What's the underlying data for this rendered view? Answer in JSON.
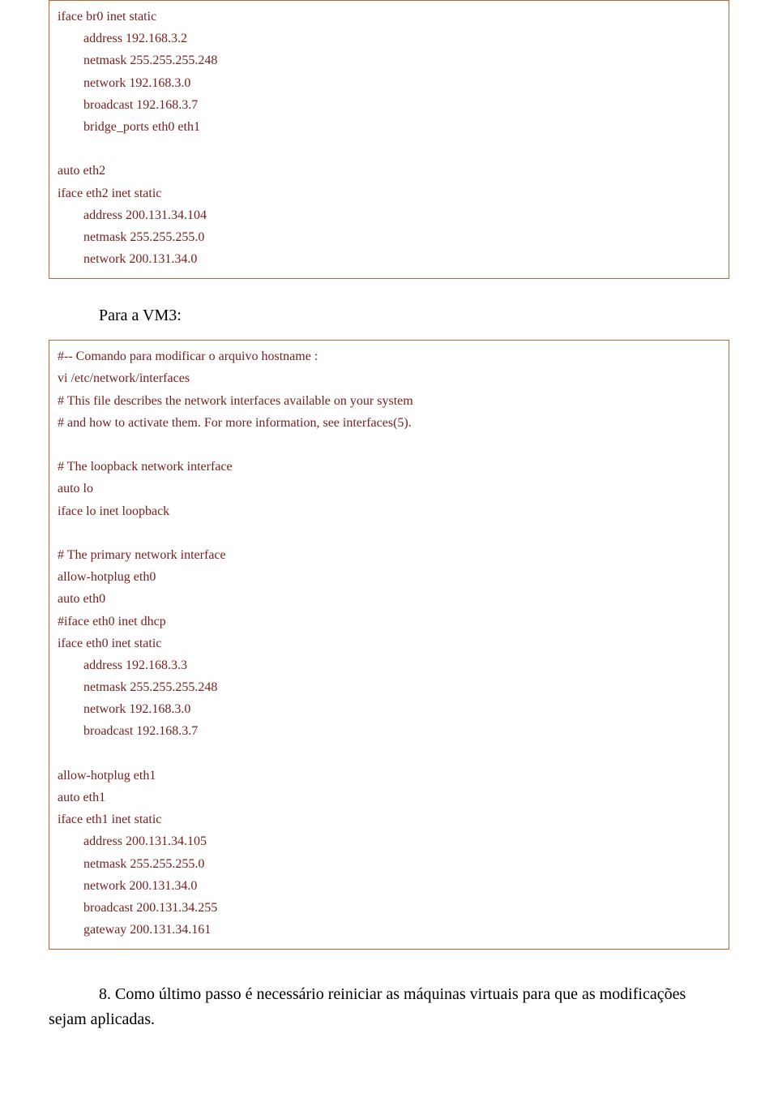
{
  "box1": {
    "lines": [
      "iface br0 inet static",
      "        address 192.168.3.2",
      "        netmask 255.255.255.248",
      "        network 192.168.3.0",
      "        broadcast 192.168.3.7",
      "        bridge_ports eth0 eth1",
      "",
      "auto eth2",
      "iface eth2 inet static",
      "        address 200.131.34.104",
      "        netmask 255.255.255.0",
      "        network 200.131.34.0"
    ]
  },
  "heading_vm3": "Para a VM3:",
  "box2": {
    "lines": [
      "#-- Comando para modificar o arquivo hostname :",
      "vi /etc/network/interfaces",
      "# This file describes the network interfaces available on your system",
      "# and how to activate them. For more information, see interfaces(5).",
      "",
      "# The loopback network interface",
      "auto lo",
      "iface lo inet loopback",
      "",
      "# The primary network interface",
      "allow-hotplug eth0",
      "auto eth0",
      "#iface eth0 inet dhcp",
      "iface eth0 inet static",
      "        address 192.168.3.3",
      "        netmask 255.255.255.248",
      "        network 192.168.3.0",
      "        broadcast 192.168.3.7",
      "",
      "allow-hotplug eth1",
      "auto eth1",
      "iface eth1 inet static",
      "        address 200.131.34.105",
      "        netmask 255.255.255.0",
      "        network 200.131.34.0",
      "        broadcast 200.131.34.255",
      "        gateway 200.131.34.161"
    ]
  },
  "step8_line1": "8.   Como  último  passo  é  necessário  reiniciar  as  máquinas  virtuais  para  que  as  modificações",
  "step8_line2": "sejam aplicadas."
}
